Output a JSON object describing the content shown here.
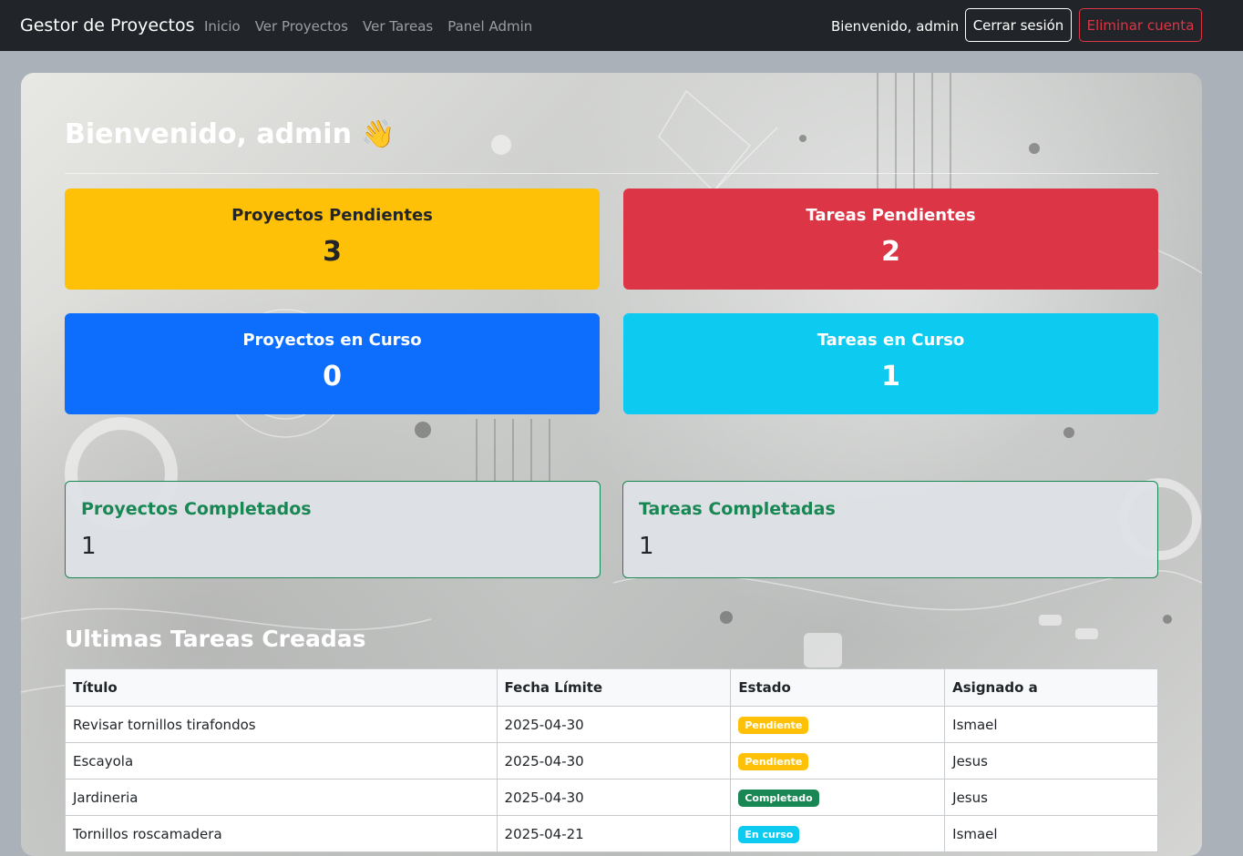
{
  "navbar": {
    "brand": "Gestor de Proyectos",
    "links": [
      "Inicio",
      "Ver Proyectos",
      "Ver Tareas",
      "Panel Admin"
    ],
    "welcome": "Bienvenido, admin",
    "logout_label": "Cerrar sesión",
    "delete_label": "Eliminar cuenta"
  },
  "main": {
    "greeting": "Bienvenido, admin 👋",
    "stats": [
      {
        "label": "Proyectos Pendientes",
        "value": "3",
        "color": "#ffc107"
      },
      {
        "label": "Tareas Pendientes",
        "value": "2",
        "color": "#dc3545"
      },
      {
        "label": "Proyectos en Curso",
        "value": "0",
        "color": "#0d6efd"
      },
      {
        "label": "Tareas en Curso",
        "value": "1",
        "color": "#0dcaf0"
      }
    ],
    "completed": [
      {
        "label": "Proyectos Completados",
        "value": "1",
        "color": "#198754"
      },
      {
        "label": "Tareas Completadas",
        "value": "1",
        "color": "#198754"
      }
    ],
    "table": {
      "title": "Ultimas Tareas Creadas",
      "headers": [
        "Título",
        "Fecha Límite",
        "Estado",
        "Asignado a"
      ],
      "rows": [
        {
          "title": "Revisar tornillos tirafondos",
          "date": "2025-04-30",
          "status": "Pendiente",
          "assignee": "Ismael"
        },
        {
          "title": "Escayola",
          "date": "2025-04-30",
          "status": "Pendiente",
          "assignee": "Jesus"
        },
        {
          "title": "Jardineria",
          "date": "2025-04-30",
          "status": "Completado",
          "assignee": "Jesus"
        },
        {
          "title": "Tornillos roscamadera",
          "date": "2025-04-21",
          "status": "En curso",
          "assignee": "Ismael"
        }
      ]
    }
  }
}
